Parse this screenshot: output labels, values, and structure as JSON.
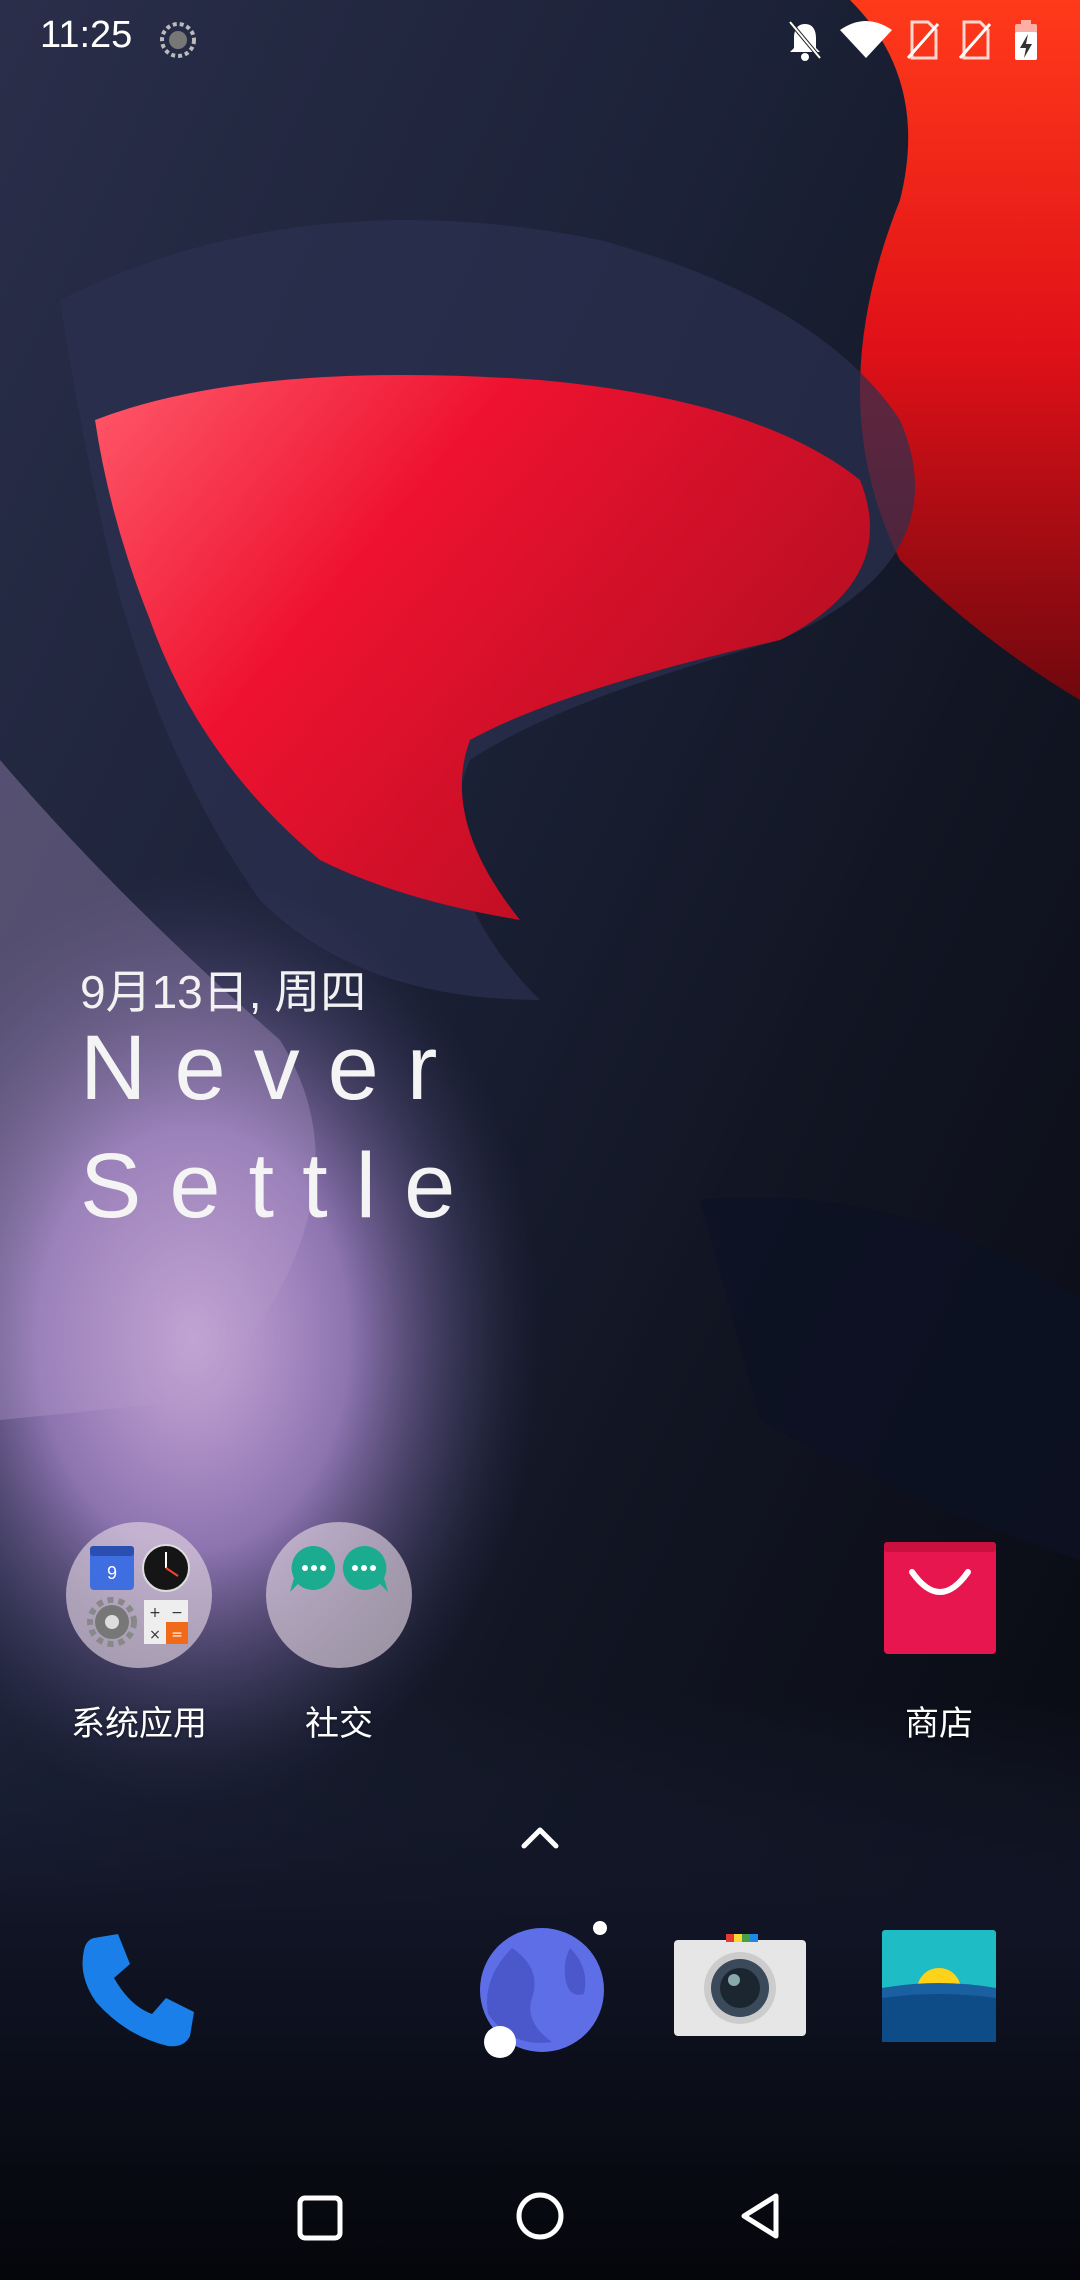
{
  "status_bar": {
    "time": "11:25",
    "icons": [
      "loading-icon",
      "bell-off-icon",
      "wifi-icon",
      "no-sim-icon",
      "no-sim-icon",
      "battery-charging-icon"
    ]
  },
  "widget": {
    "date": "9月13日, 周四",
    "slogan_line1": "Never",
    "slogan_line2": "Settle"
  },
  "home_apps": [
    {
      "label": "系统应用",
      "icon": "system-apps-folder-icon"
    },
    {
      "label": "社交",
      "icon": "social-folder-icon"
    },
    {
      "label": "商店",
      "icon": "store-icon"
    }
  ],
  "dock": {
    "apps": [
      "phone-icon",
      "browser-icon",
      "camera-icon",
      "gallery-icon"
    ]
  },
  "nav_bar": {
    "buttons": [
      "recents-button",
      "home-button",
      "back-button"
    ]
  },
  "colors": {
    "accent_red": "#e8102e",
    "phone_blue": "#1a7fe8",
    "store_pink": "#e8164e",
    "folder_green": "#1bab8f"
  }
}
